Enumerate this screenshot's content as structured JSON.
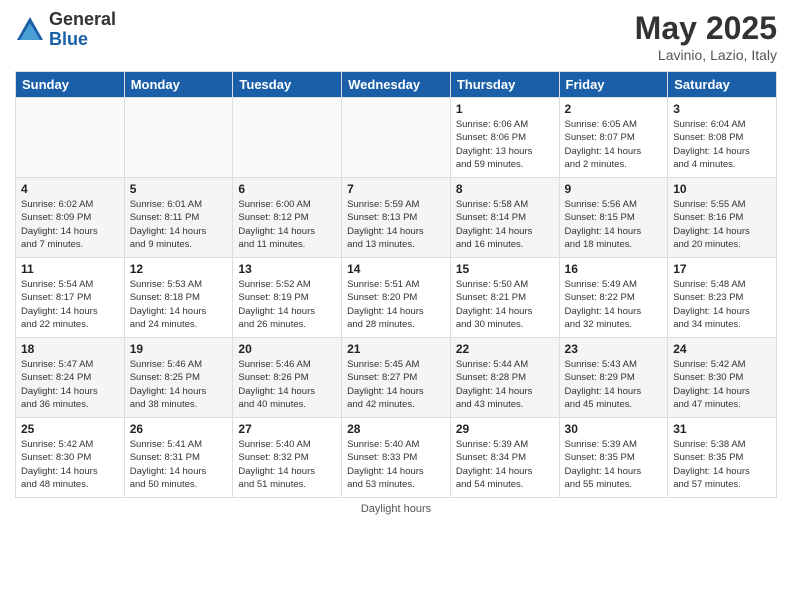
{
  "logo": {
    "general": "General",
    "blue": "Blue"
  },
  "title": "May 2025",
  "location": "Lavinio, Lazio, Italy",
  "days_of_week": [
    "Sunday",
    "Monday",
    "Tuesday",
    "Wednesday",
    "Thursday",
    "Friday",
    "Saturday"
  ],
  "footer": "Daylight hours",
  "weeks": [
    [
      {
        "day": "",
        "info": ""
      },
      {
        "day": "",
        "info": ""
      },
      {
        "day": "",
        "info": ""
      },
      {
        "day": "",
        "info": ""
      },
      {
        "day": "1",
        "info": "Sunrise: 6:06 AM\nSunset: 8:06 PM\nDaylight: 13 hours\nand 59 minutes."
      },
      {
        "day": "2",
        "info": "Sunrise: 6:05 AM\nSunset: 8:07 PM\nDaylight: 14 hours\nand 2 minutes."
      },
      {
        "day": "3",
        "info": "Sunrise: 6:04 AM\nSunset: 8:08 PM\nDaylight: 14 hours\nand 4 minutes."
      }
    ],
    [
      {
        "day": "4",
        "info": "Sunrise: 6:02 AM\nSunset: 8:09 PM\nDaylight: 14 hours\nand 7 minutes."
      },
      {
        "day": "5",
        "info": "Sunrise: 6:01 AM\nSunset: 8:11 PM\nDaylight: 14 hours\nand 9 minutes."
      },
      {
        "day": "6",
        "info": "Sunrise: 6:00 AM\nSunset: 8:12 PM\nDaylight: 14 hours\nand 11 minutes."
      },
      {
        "day": "7",
        "info": "Sunrise: 5:59 AM\nSunset: 8:13 PM\nDaylight: 14 hours\nand 13 minutes."
      },
      {
        "day": "8",
        "info": "Sunrise: 5:58 AM\nSunset: 8:14 PM\nDaylight: 14 hours\nand 16 minutes."
      },
      {
        "day": "9",
        "info": "Sunrise: 5:56 AM\nSunset: 8:15 PM\nDaylight: 14 hours\nand 18 minutes."
      },
      {
        "day": "10",
        "info": "Sunrise: 5:55 AM\nSunset: 8:16 PM\nDaylight: 14 hours\nand 20 minutes."
      }
    ],
    [
      {
        "day": "11",
        "info": "Sunrise: 5:54 AM\nSunset: 8:17 PM\nDaylight: 14 hours\nand 22 minutes."
      },
      {
        "day": "12",
        "info": "Sunrise: 5:53 AM\nSunset: 8:18 PM\nDaylight: 14 hours\nand 24 minutes."
      },
      {
        "day": "13",
        "info": "Sunrise: 5:52 AM\nSunset: 8:19 PM\nDaylight: 14 hours\nand 26 minutes."
      },
      {
        "day": "14",
        "info": "Sunrise: 5:51 AM\nSunset: 8:20 PM\nDaylight: 14 hours\nand 28 minutes."
      },
      {
        "day": "15",
        "info": "Sunrise: 5:50 AM\nSunset: 8:21 PM\nDaylight: 14 hours\nand 30 minutes."
      },
      {
        "day": "16",
        "info": "Sunrise: 5:49 AM\nSunset: 8:22 PM\nDaylight: 14 hours\nand 32 minutes."
      },
      {
        "day": "17",
        "info": "Sunrise: 5:48 AM\nSunset: 8:23 PM\nDaylight: 14 hours\nand 34 minutes."
      }
    ],
    [
      {
        "day": "18",
        "info": "Sunrise: 5:47 AM\nSunset: 8:24 PM\nDaylight: 14 hours\nand 36 minutes."
      },
      {
        "day": "19",
        "info": "Sunrise: 5:46 AM\nSunset: 8:25 PM\nDaylight: 14 hours\nand 38 minutes."
      },
      {
        "day": "20",
        "info": "Sunrise: 5:46 AM\nSunset: 8:26 PM\nDaylight: 14 hours\nand 40 minutes."
      },
      {
        "day": "21",
        "info": "Sunrise: 5:45 AM\nSunset: 8:27 PM\nDaylight: 14 hours\nand 42 minutes."
      },
      {
        "day": "22",
        "info": "Sunrise: 5:44 AM\nSunset: 8:28 PM\nDaylight: 14 hours\nand 43 minutes."
      },
      {
        "day": "23",
        "info": "Sunrise: 5:43 AM\nSunset: 8:29 PM\nDaylight: 14 hours\nand 45 minutes."
      },
      {
        "day": "24",
        "info": "Sunrise: 5:42 AM\nSunset: 8:30 PM\nDaylight: 14 hours\nand 47 minutes."
      }
    ],
    [
      {
        "day": "25",
        "info": "Sunrise: 5:42 AM\nSunset: 8:30 PM\nDaylight: 14 hours\nand 48 minutes."
      },
      {
        "day": "26",
        "info": "Sunrise: 5:41 AM\nSunset: 8:31 PM\nDaylight: 14 hours\nand 50 minutes."
      },
      {
        "day": "27",
        "info": "Sunrise: 5:40 AM\nSunset: 8:32 PM\nDaylight: 14 hours\nand 51 minutes."
      },
      {
        "day": "28",
        "info": "Sunrise: 5:40 AM\nSunset: 8:33 PM\nDaylight: 14 hours\nand 53 minutes."
      },
      {
        "day": "29",
        "info": "Sunrise: 5:39 AM\nSunset: 8:34 PM\nDaylight: 14 hours\nand 54 minutes."
      },
      {
        "day": "30",
        "info": "Sunrise: 5:39 AM\nSunset: 8:35 PM\nDaylight: 14 hours\nand 55 minutes."
      },
      {
        "day": "31",
        "info": "Sunrise: 5:38 AM\nSunset: 8:35 PM\nDaylight: 14 hours\nand 57 minutes."
      }
    ]
  ]
}
